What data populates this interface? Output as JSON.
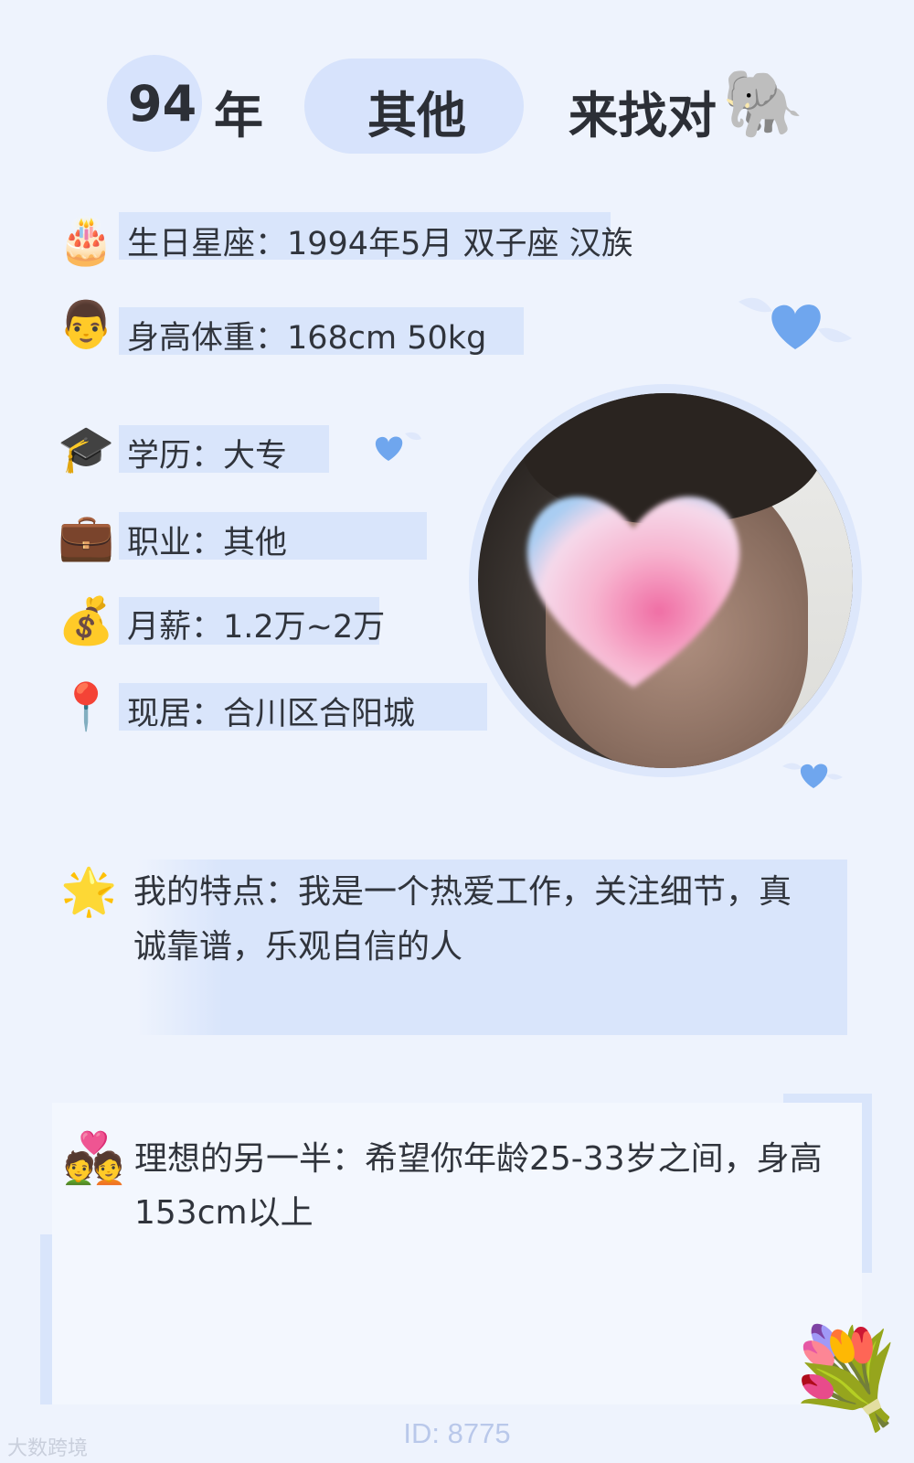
{
  "header": {
    "year_number": "94",
    "year_unit": "年",
    "category": "其他",
    "seeking": "来找对"
  },
  "icons": {
    "elephant": "🐘",
    "cake": "🎂",
    "man": "👨",
    "graduation": "🎓",
    "briefcase": "💼",
    "money_bag": "💰",
    "pin": "📍",
    "star": "🌟",
    "couple": "💑",
    "bouquet": "💐"
  },
  "profile": {
    "birthday": "生日星座：1994年5月 双子座 汉族",
    "height_weight": "身高体重：168cm 50kg",
    "education": "学历：大专",
    "occupation": "职业：其他",
    "salary": "月薪：1.2万~2万",
    "residence": "现居：合川区合阳城"
  },
  "features": {
    "line1": "我的特点：我是一个热爱工作，关注细节，真",
    "line2": "诚靠谱，乐观自信的人"
  },
  "ideal": {
    "line1": "理想的另一半：希望你年龄25-33岁之间，身高",
    "line2": "153cm以上"
  },
  "footer": {
    "id_text": "ID: 8775",
    "watermark": "大数跨境"
  },
  "colors": {
    "background": "#eef3fd",
    "highlight": "#d9e5fb",
    "heart_blue": "#6fa6ee",
    "id_text": "#b9c8ea"
  }
}
